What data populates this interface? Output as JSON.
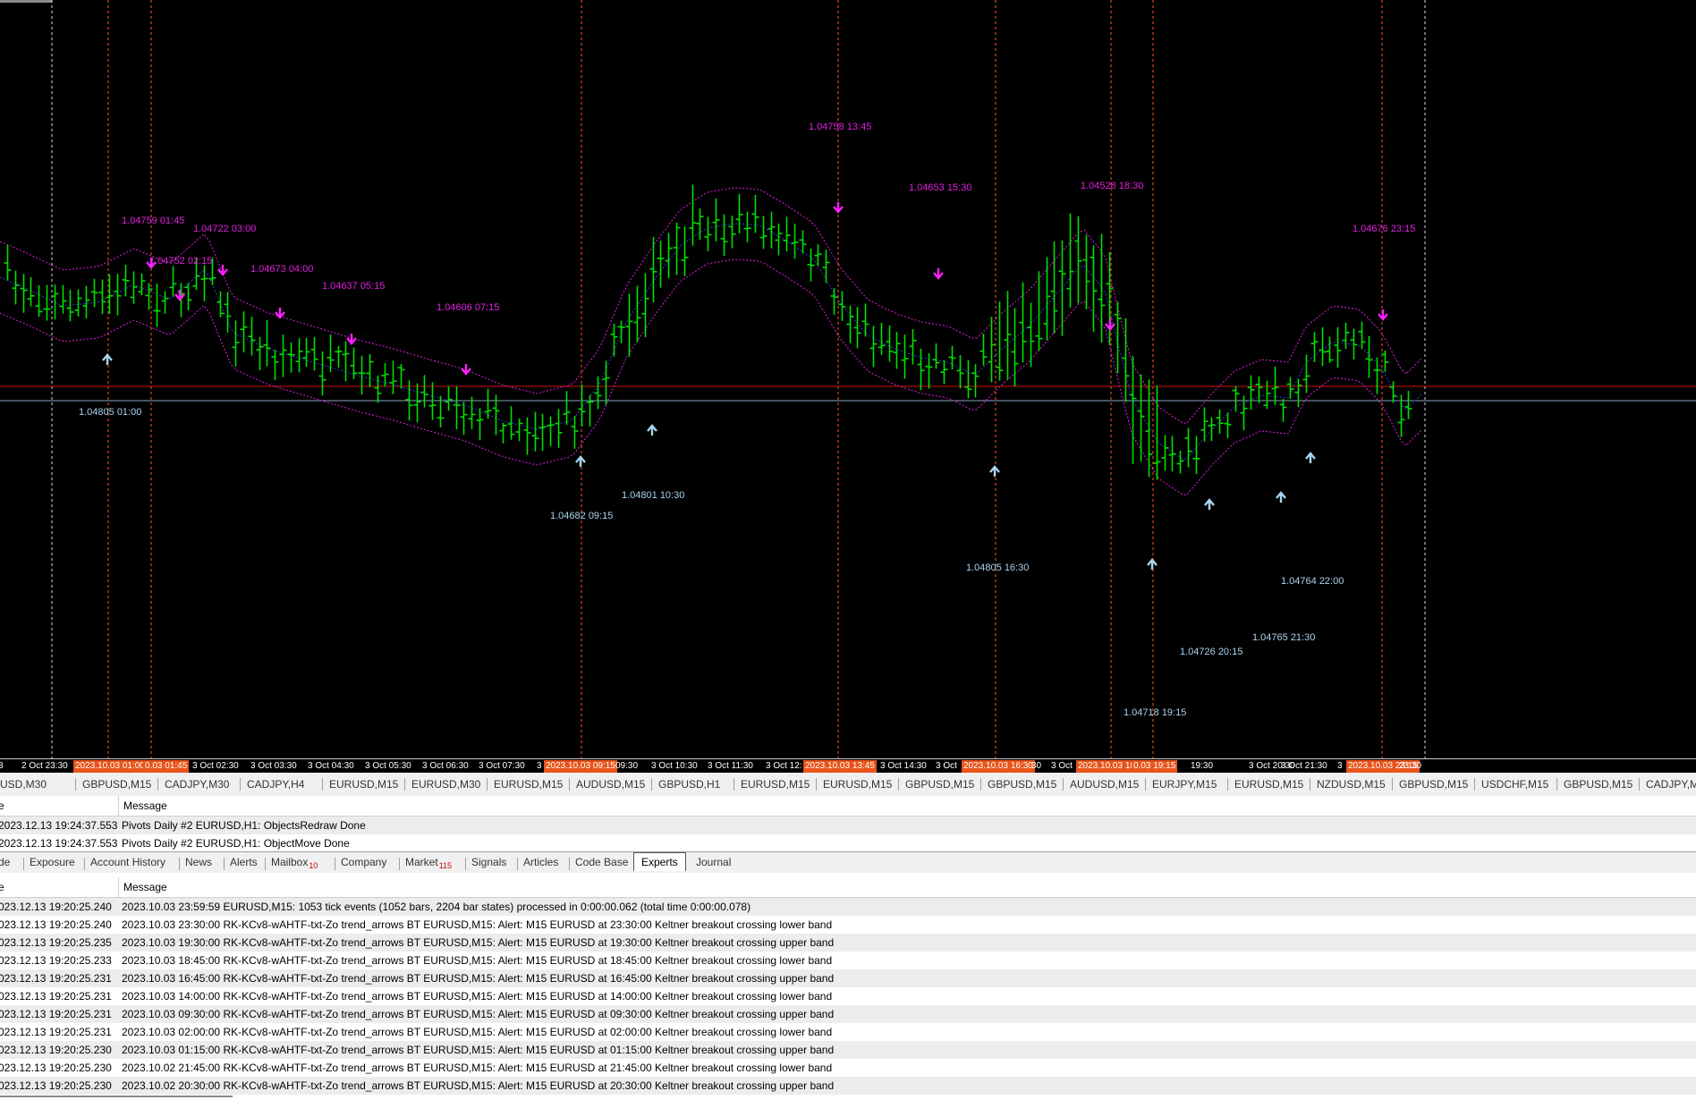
{
  "colors": {
    "candle": "#00e000",
    "band": "#e020e0",
    "mid": "#3040d0",
    "down_arrow": "#ff20ff",
    "up_arrow": "#a8d4f0",
    "vline": "#ff5a1f",
    "hline_red": "#d01010",
    "hline_steel": "#8aa4bc",
    "highlight": "#e8541a"
  },
  "chart": {
    "symbol": "EURUSD",
    "timeframe": "M15",
    "hlines": [
      {
        "kind": "red",
        "price": 1.0484
      },
      {
        "kind": "steel",
        "price": 1.04805
      }
    ],
    "top_labels": [
      {
        "text": "1.04759 01:45"
      },
      {
        "text": "1.04722 03:00"
      },
      {
        "text": "1.04752 02:15"
      },
      {
        "text": "1.04673 04:00"
      },
      {
        "text": "1.04637 05:15"
      },
      {
        "text": "1.04606 07:15"
      },
      {
        "text": "1.04758 13:45"
      },
      {
        "text": "1.04653 15:30"
      },
      {
        "text": "1.04528 18:30"
      },
      {
        "text": "1.04676 23:15"
      }
    ],
    "bottom_labels": [
      {
        "text": "1.04805 01:00"
      },
      {
        "text": "1.04682 09:15"
      },
      {
        "text": "1.04801 10:30"
      },
      {
        "text": "1.04805 16:30"
      },
      {
        "text": "1.04764 22:00"
      },
      {
        "text": "1.04765 21:30"
      },
      {
        "text": "1.04726 20:15"
      },
      {
        "text": "1.04718 19:15"
      }
    ]
  },
  "time_axis": [
    {
      "text": "3",
      "hl": false
    },
    {
      "text": "2 Oct 23:30",
      "hl": false
    },
    {
      "text": "2023.10.03 01:00",
      "hl": true
    },
    {
      "text": "0.03 01:45",
      "hl": true
    },
    {
      "text": "3 Oct 02:30",
      "hl": false
    },
    {
      "text": "3 Oct 03:30",
      "hl": false
    },
    {
      "text": "3 Oct 04:30",
      "hl": false
    },
    {
      "text": "3 Oct 05:30",
      "hl": false
    },
    {
      "text": "3 Oct 06:30",
      "hl": false
    },
    {
      "text": "3 Oct 07:30",
      "hl": false
    },
    {
      "text": "3",
      "hl": false
    },
    {
      "text": "2023.10.03 09:15",
      "hl": true
    },
    {
      "text": "09:30",
      "hl": false
    },
    {
      "text": "3 Oct 10:30",
      "hl": false
    },
    {
      "text": "3 Oct 11:30",
      "hl": false
    },
    {
      "text": "3 Oct 12:",
      "hl": false
    },
    {
      "text": "2023.10.03 13:45",
      "hl": true
    },
    {
      "text": "3 Oct 14:30",
      "hl": false
    },
    {
      "text": "3 Oct",
      "hl": false
    },
    {
      "text": "2023.10.03 16:30",
      "hl": true
    },
    {
      "text": "30",
      "hl": false
    },
    {
      "text": "3 Oct",
      "hl": false
    },
    {
      "text": "2023.10.03 18:30",
      "hl": true
    },
    {
      "text": "0.03 19:15",
      "hl": true
    },
    {
      "text": "19:30",
      "hl": false
    },
    {
      "text": "3 Oct 20:30",
      "hl": false
    },
    {
      "text": "3 Oct 21:30",
      "hl": false
    },
    {
      "text": "3",
      "hl": false
    },
    {
      "text": "2023.10.03 23:15",
      "hl": true
    },
    {
      "text": "23:30",
      "hl": false
    }
  ],
  "symbol_tabs": [
    "USD,M30",
    "GBPUSD,M15",
    "CADJPY,M30",
    "CADJPY,H4",
    "EURUSD,M15",
    "EURUSD,M30",
    "EURUSD,M15",
    "AUDUSD,M15",
    "GBPUSD,H1",
    "EURUSD,M15",
    "EURUSD,M15",
    "GBPUSD,M15",
    "GBPUSD,M15",
    "AUDUSD,M15",
    "EURJPY,M15",
    "EURUSD,M15",
    "NZDUSD,M15",
    "GBPUSD,M15",
    "USDCHF,M15",
    "GBPUSD,M15",
    "CADJPY,M15"
  ],
  "journal": {
    "col_time": "e",
    "col_message": "Message",
    "rows": [
      {
        "time": "2023.12.13 19:24:37.553",
        "message": "Pivots Daily #2 EURUSD,H1: ObjectsRedraw Done"
      },
      {
        "time": "2023.12.13 19:24:37.553",
        "message": "Pivots Daily #2 EURUSD,H1: ObjectMove Done"
      }
    ]
  },
  "terminal_tabs": [
    {
      "label": "de",
      "badge": "",
      "active": false
    },
    {
      "label": "Exposure",
      "badge": "",
      "active": false
    },
    {
      "label": "Account History",
      "badge": "",
      "active": false
    },
    {
      "label": "News",
      "badge": "",
      "active": false
    },
    {
      "label": "Alerts",
      "badge": "",
      "active": false
    },
    {
      "label": "Mailbox",
      "badge": "10",
      "active": false
    },
    {
      "label": "Company",
      "badge": "",
      "active": false
    },
    {
      "label": "Market",
      "badge": "115",
      "active": false
    },
    {
      "label": "Signals",
      "badge": "",
      "active": false
    },
    {
      "label": "Articles",
      "badge": "",
      "active": false
    },
    {
      "label": "Code Base",
      "badge": "",
      "active": false
    },
    {
      "label": "Experts",
      "badge": "",
      "active": true
    },
    {
      "label": "Journal",
      "badge": "",
      "active": false
    }
  ],
  "experts": {
    "col_time": "e",
    "col_message": "Message",
    "rows": [
      {
        "time": "023.12.13 19:20:25.240",
        "message": "2023.10.03 23:59:59  EURUSD,M15: 1053 tick events (1052 bars, 2204 bar states) processed in 0:00:00.062 (total time 0:00:00.078)"
      },
      {
        "time": "023.12.13 19:20:25.240",
        "message": "2023.10.03 23:30:00  RK-KCv8-wAHTF-txt-Zo trend_arrows BT EURUSD,M15: Alert: M15 EURUSD at 23:30:00 Keltner breakout  crossing lower band"
      },
      {
        "time": "023.12.13 19:20:25.235",
        "message": "2023.10.03 19:30:00  RK-KCv8-wAHTF-txt-Zo trend_arrows BT EURUSD,M15: Alert: M15 EURUSD at 19:30:00 Keltner breakout  crossing upper band"
      },
      {
        "time": "023.12.13 19:20:25.233",
        "message": "2023.10.03 18:45:00  RK-KCv8-wAHTF-txt-Zo trend_arrows BT EURUSD,M15: Alert: M15 EURUSD at 18:45:00 Keltner breakout  crossing lower band"
      },
      {
        "time": "023.12.13 19:20:25.231",
        "message": "2023.10.03 16:45:00  RK-KCv8-wAHTF-txt-Zo trend_arrows BT EURUSD,M15: Alert: M15 EURUSD at 16:45:00 Keltner breakout  crossing upper band"
      },
      {
        "time": "023.12.13 19:20:25.231",
        "message": "2023.10.03 14:00:00  RK-KCv8-wAHTF-txt-Zo trend_arrows BT EURUSD,M15: Alert: M15 EURUSD at 14:00:00 Keltner breakout  crossing lower band"
      },
      {
        "time": "023.12.13 19:20:25.231",
        "message": "2023.10.03 09:30:00  RK-KCv8-wAHTF-txt-Zo trend_arrows BT EURUSD,M15: Alert: M15 EURUSD at 09:30:00 Keltner breakout  crossing upper band"
      },
      {
        "time": "023.12.13 19:20:25.231",
        "message": "2023.10.03 02:00:00  RK-KCv8-wAHTF-txt-Zo trend_arrows BT EURUSD,M15: Alert: M15 EURUSD at 02:00:00 Keltner breakout  crossing lower band"
      },
      {
        "time": "023.12.13 19:20:25.230",
        "message": "2023.10.03 01:15:00  RK-KCv8-wAHTF-txt-Zo trend_arrows BT EURUSD,M15: Alert: M15 EURUSD at 01:15:00 Keltner breakout  crossing upper band"
      },
      {
        "time": "023.12.13 19:20:25.230",
        "message": "2023.10.02 21:45:00  RK-KCv8-wAHTF-txt-Zo trend_arrows BT EURUSD,M15: Alert: M15 EURUSD at 21:45:00 Keltner breakout  crossing lower band"
      },
      {
        "time": "023.12.13 19:20:25.230",
        "message": "2023.10.02 20:30:00  RK-KCv8-wAHTF-txt-Zo trend_arrows BT EURUSD,M15: Alert: M15 EURUSD at 20:30:00 Keltner breakout  crossing upper band"
      }
    ]
  }
}
